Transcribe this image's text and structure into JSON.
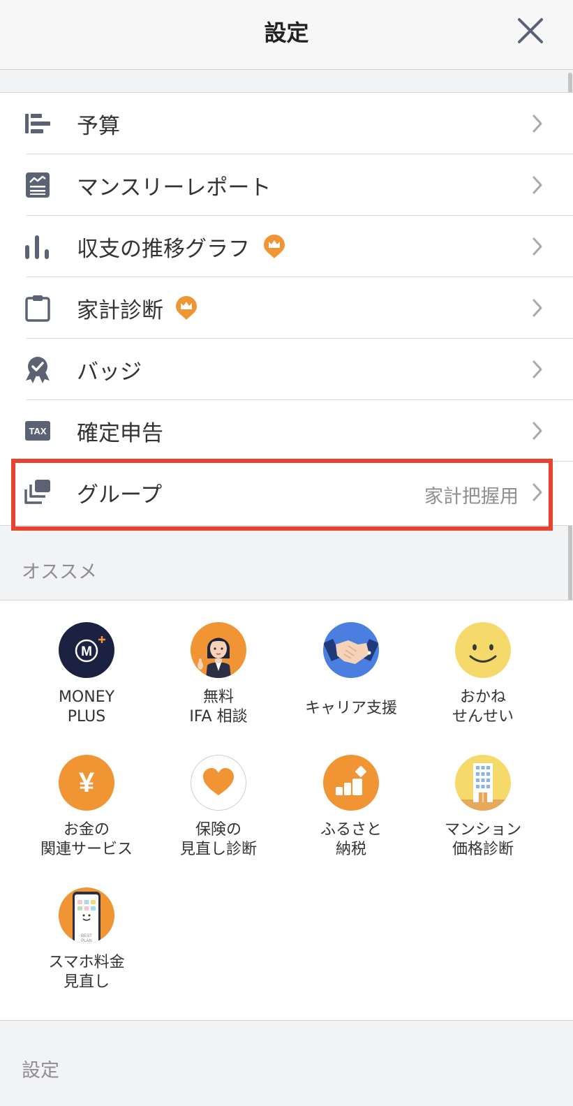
{
  "header": {
    "title": "設定"
  },
  "menu": [
    {
      "label": "予算",
      "icon": "budget-bars-icon"
    },
    {
      "label": "マンスリーレポート",
      "icon": "report-chart-icon"
    },
    {
      "label": "収支の推移グラフ",
      "icon": "bar-graph-icon",
      "premium": true
    },
    {
      "label": "家計診断",
      "icon": "clipboard-icon",
      "premium": true
    },
    {
      "label": "バッジ",
      "icon": "badge-ribbon-icon"
    },
    {
      "label": "確定申告",
      "icon": "tax-icon",
      "icon_text": "TAX"
    },
    {
      "label": "グループ",
      "icon": "group-stack-icon",
      "value": "家計把握用"
    }
  ],
  "recommend": {
    "heading": "オススメ",
    "items": [
      {
        "label": "MONEY\nPLUS",
        "icon": "money-plus-logo-icon",
        "logo_text": "M"
      },
      {
        "label": "無料\nIFA 相談",
        "icon": "advisor-woman-icon"
      },
      {
        "label": "キャリア支援",
        "icon": "handshake-icon"
      },
      {
        "label": "おかね\nせんせい",
        "icon": "smiley-face-icon"
      },
      {
        "label": "お金の\n関連サービス",
        "icon": "yen-icon",
        "symbol": "¥"
      },
      {
        "label": "保険の\n見直し診断",
        "icon": "heart-icon"
      },
      {
        "label": "ふるさと\n納税",
        "icon": "hometown-tax-icon"
      },
      {
        "label": "マンション\n価格診断",
        "icon": "building-icon"
      },
      {
        "label": "スマホ料金\n見直し",
        "icon": "smartphone-plan-icon",
        "screen_text": [
          "BEST",
          "PLAN"
        ]
      }
    ]
  },
  "settings_section": {
    "heading": "設定"
  },
  "colors": {
    "accent_orange": "#f19433",
    "highlight_red": "#e8432d",
    "icon_slate": "#5a6273",
    "navy": "#1b2140",
    "blue": "#4a7fe0",
    "yellow": "#f6d96b"
  }
}
